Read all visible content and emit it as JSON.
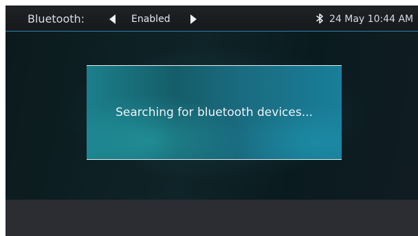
{
  "header": {
    "label": "Bluetooth:",
    "value": "Enabled",
    "left_arrow_icon": "triangle-left-icon",
    "right_arrow_icon": "triangle-right-icon",
    "status_icon": "bluetooth-icon",
    "datetime": "24 May 10:44 AM"
  },
  "dialog": {
    "message": "Searching for bluetooth devices..."
  },
  "colors": {
    "topbar_border": "#2f7fb4",
    "dialog_teal": "#1a6b7f",
    "background": "#0f2428",
    "bottom_panel": "#2b2d33"
  }
}
